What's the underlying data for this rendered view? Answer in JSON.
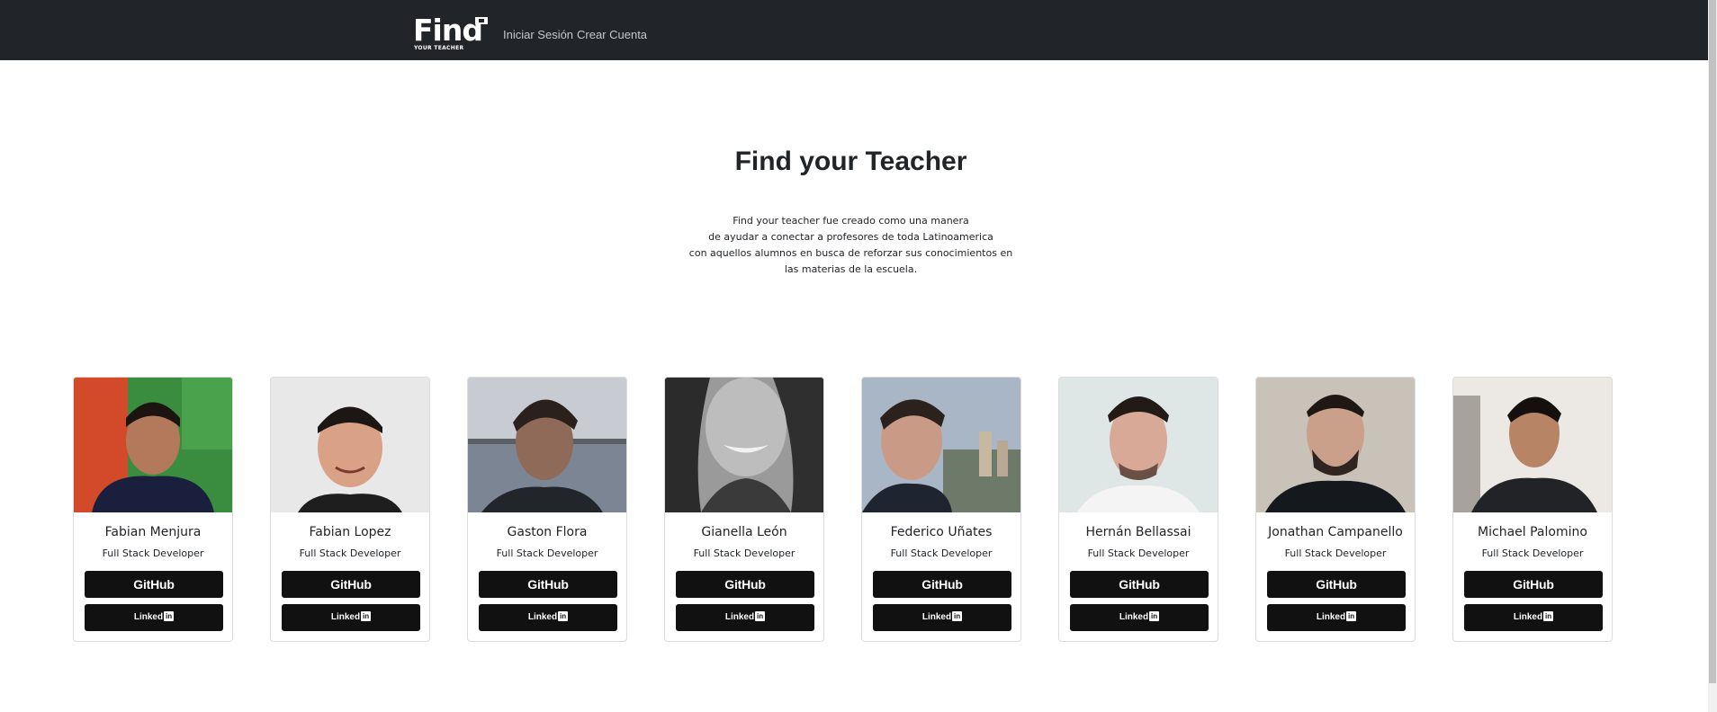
{
  "navbar": {
    "logo_main": "Find",
    "logo_sub": "YOUR TEACHER",
    "links": [
      "Iniciar Sesión",
      "Crear Cuenta"
    ]
  },
  "hero": {
    "title": "Find your Teacher",
    "description_lines": [
      "Find your teacher fue creado como una manera",
      "de ayudar a conectar a profesores de toda Latinoamerica",
      "con aquellos alumnos en busca de reforzar sus conocimientos en",
      "las materias de la escuela."
    ]
  },
  "team": [
    {
      "name": "Fabian Menjura",
      "role": "Full Stack Developer",
      "github_label": "GitHub",
      "linkedin_label": "Linked"
    },
    {
      "name": "Fabian Lopez",
      "role": "Full Stack Developer",
      "github_label": "GitHub",
      "linkedin_label": "Linked"
    },
    {
      "name": "Gaston Flora",
      "role": "Full Stack Developer",
      "github_label": "GitHub",
      "linkedin_label": "Linked"
    },
    {
      "name": "Gianella León",
      "role": "Full Stack Developer",
      "github_label": "GitHub",
      "linkedin_label": "Linked"
    },
    {
      "name": "Federico Uñates",
      "role": "Full Stack Developer",
      "github_label": "GitHub",
      "linkedin_label": "Linked"
    },
    {
      "name": "Hernán Bellassai",
      "role": "Full Stack Developer",
      "github_label": "GitHub",
      "linkedin_label": "Linked"
    },
    {
      "name": "Jonathan Campanello",
      "role": "Full Stack Developer",
      "github_label": "GitHub",
      "linkedin_label": "Linked"
    },
    {
      "name": "Michael Palomino",
      "role": "Full Stack Developer",
      "github_label": "GitHub",
      "linkedin_label": "Linked"
    }
  ],
  "linkedin_badge": "in",
  "colors": {
    "navbar": "#212529",
    "button": "#111111",
    "text": "#212529"
  }
}
